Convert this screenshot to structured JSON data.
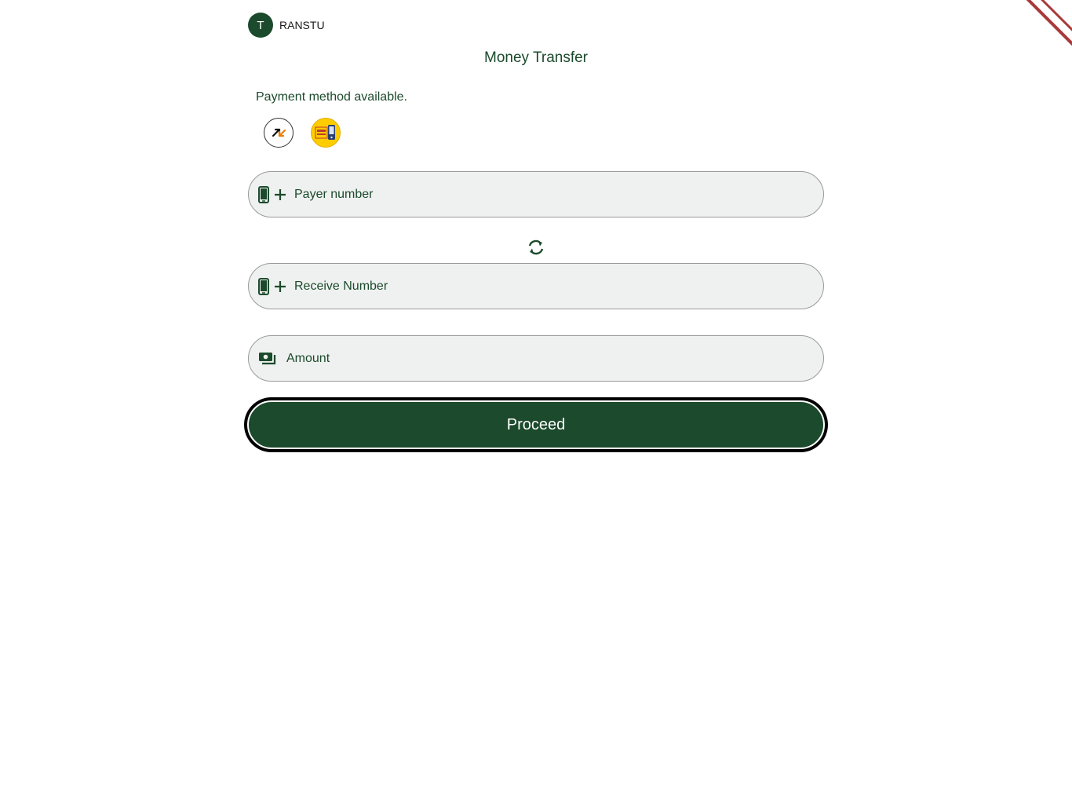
{
  "user": {
    "avatar_initial": "T",
    "name": "RANSTU"
  },
  "page": {
    "title": "Money Transfer"
  },
  "payment_methods": {
    "label": "Payment method available.",
    "methods": [
      {
        "name": "airtel-money-icon"
      },
      {
        "name": "mtn-mobile-money-icon"
      }
    ]
  },
  "form": {
    "payer_placeholder": "Payer number",
    "receiver_placeholder": "Receive Number",
    "amount_placeholder": "Amount",
    "proceed_label": "Proceed"
  },
  "colors": {
    "primary": "#1c4a2c",
    "field_bg": "#eff1f0",
    "ribbon": "#a83a3a",
    "mtn_yellow": "#ffcc00",
    "airtel_orange": "#f07c00"
  }
}
